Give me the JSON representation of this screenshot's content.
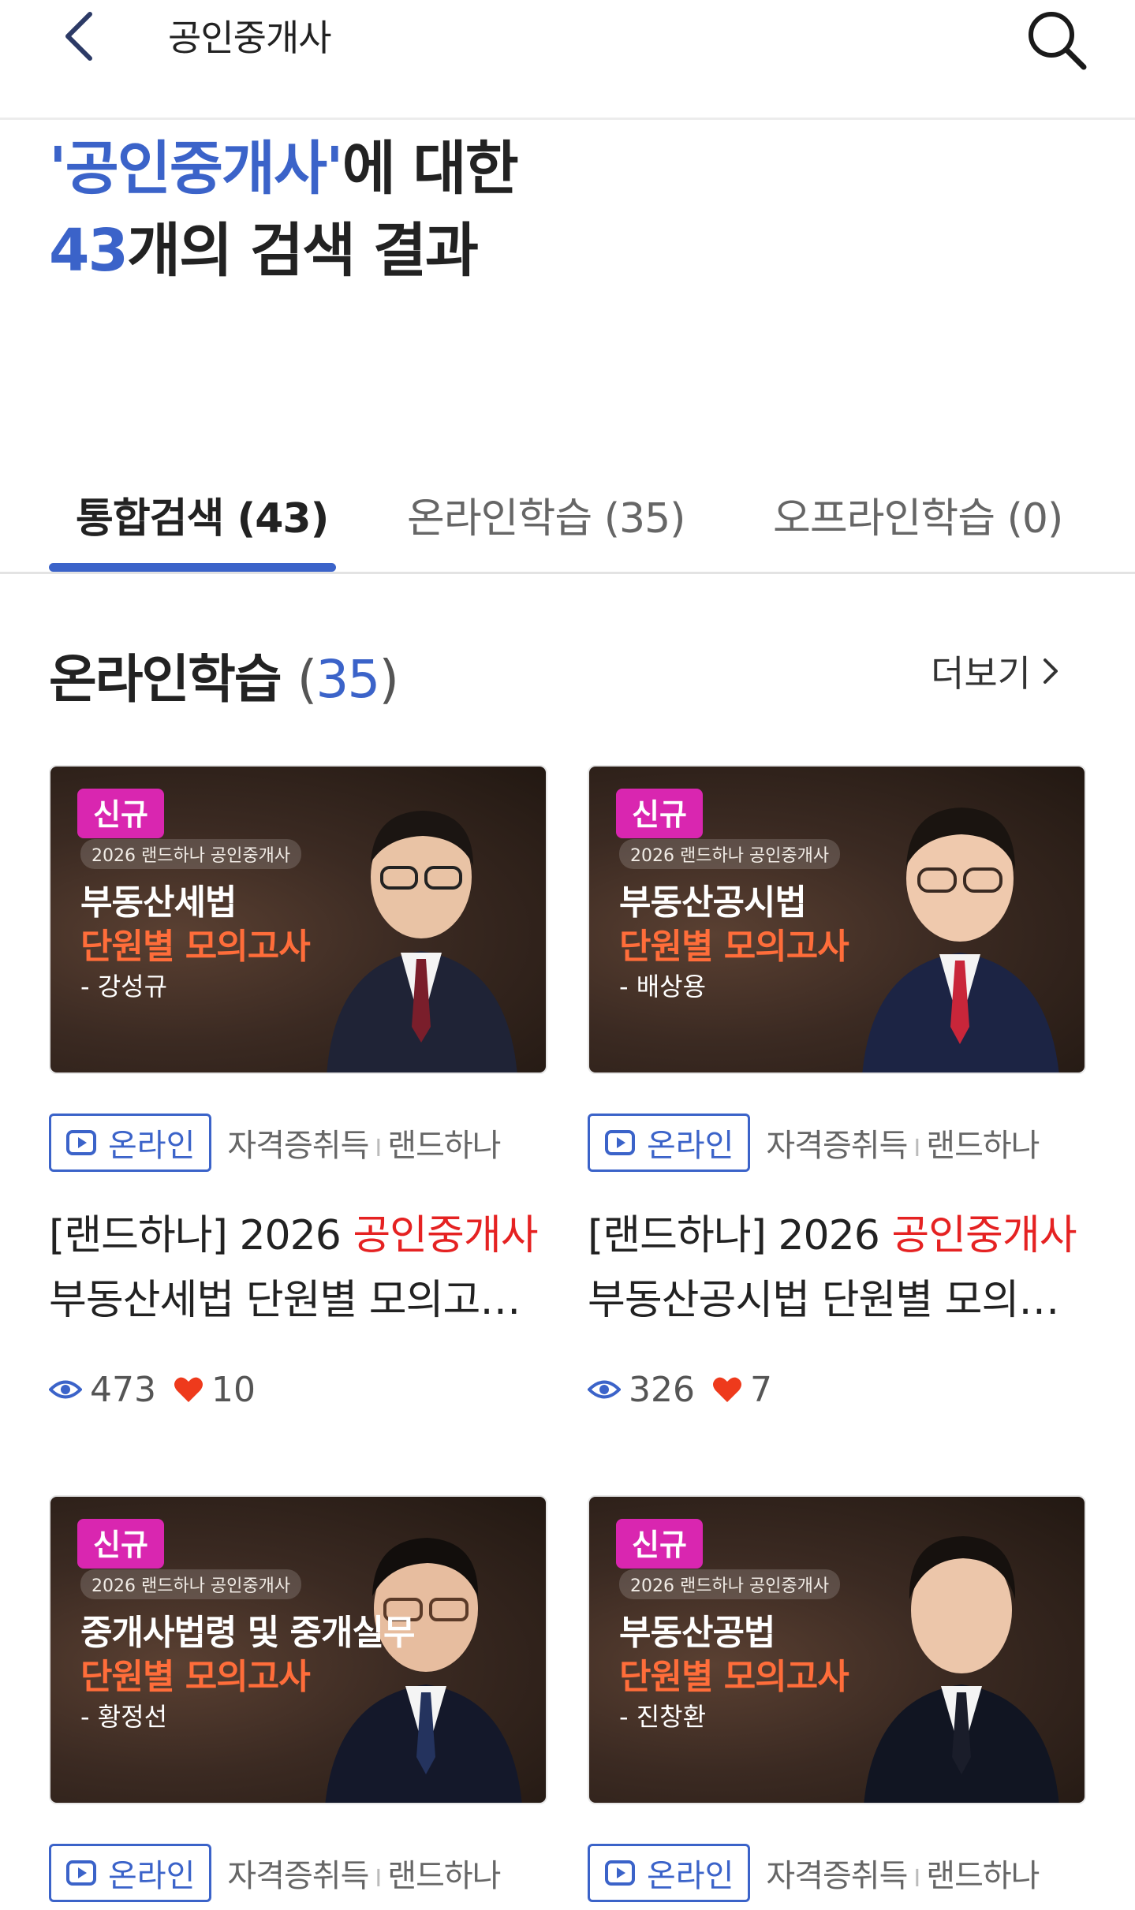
{
  "header": {
    "title": "공인중개사",
    "back_icon": "chevron-left-icon",
    "search_icon": "search-icon"
  },
  "result": {
    "quote_keyword": "'공인중개사'",
    "line1_suffix": "에 대한",
    "count": "43",
    "line2_suffix": "개의 검색 결과"
  },
  "tabs": [
    {
      "label": "통합검색 (43)",
      "active": true
    },
    {
      "label": "온라인학습 (35)",
      "active": false
    },
    {
      "label": "오프라인학습 (0)",
      "active": false
    }
  ],
  "section": {
    "title": "온라인학습",
    "count_open": "(",
    "count": "35",
    "count_close": ")",
    "more": "더보기"
  },
  "courses": [
    {
      "badge": "신규",
      "sub": "2026 랜드하나 공인중개사",
      "thumb_line1": "부동산세법",
      "thumb_line2": "단원별 모의고사",
      "thumb_line3": "- 강성규",
      "tag": "온라인",
      "category": "자격증취득",
      "separator": "I",
      "provider": "랜드하나",
      "title_prefix": "[랜드하나] 2026 ",
      "title_highlight": "공인중개사",
      "title_line2": "부동산세법 단원별 모의고사...",
      "views": "473",
      "likes": "10"
    },
    {
      "badge": "신규",
      "sub": "2026 랜드하나 공인중개사",
      "thumb_line1": "부동산공시법",
      "thumb_line2": "단원별 모의고사",
      "thumb_line3": "- 배상용",
      "tag": "온라인",
      "category": "자격증취득",
      "separator": "I",
      "provider": "랜드하나",
      "title_prefix": "[랜드하나] 2026 ",
      "title_highlight": "공인중개사",
      "title_line2": "부동산공시법 단원별 모의고...",
      "views": "326",
      "likes": "7"
    },
    {
      "badge": "신규",
      "sub": "2026 랜드하나 공인중개사",
      "thumb_line1": "중개사법령 및 중개실무",
      "thumb_line2": "단원별 모의고사",
      "thumb_line3": "- 황정선",
      "tag": "온라인",
      "category": "자격증취득",
      "separator": "I",
      "provider": "랜드하나"
    },
    {
      "badge": "신규",
      "sub": "2026 랜드하나 공인중개사",
      "thumb_line1": "부동산공법",
      "thumb_line2": "단원별 모의고사",
      "thumb_line3": "- 진창환",
      "tag": "온라인",
      "category": "자격증취득",
      "separator": "I",
      "provider": "랜드하나"
    }
  ],
  "colors": {
    "accent": "#3b63c9",
    "highlight": "#e52222",
    "badge": "#d926b0",
    "thumb_orange": "#ff6d3a",
    "heart": "#ee3a1c"
  }
}
